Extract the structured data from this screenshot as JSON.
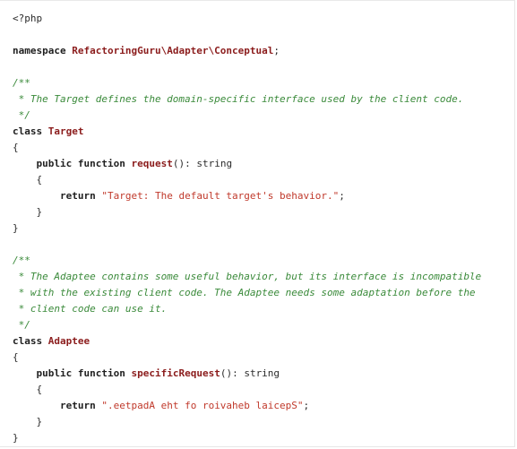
{
  "colors": {
    "background": "#ffffff",
    "text": "#2b2b2b",
    "keyword": "#1f1f1f",
    "class_name": "#8b1c1c",
    "function_name": "#8b1c1c",
    "string": "#c0392b",
    "comment": "#3a8a3a"
  },
  "lines": [
    [
      {
        "t": "<?php",
        "k": "plain"
      }
    ],
    [],
    [
      {
        "t": "namespace",
        "k": "keyword"
      },
      {
        "t": " ",
        "k": "plain"
      },
      {
        "t": "RefactoringGuru\\Adapter\\Conceptual",
        "k": "class"
      },
      {
        "t": ";",
        "k": "plain"
      }
    ],
    [],
    [
      {
        "t": "/**",
        "k": "comment"
      }
    ],
    [
      {
        "t": " * The Target defines the domain-specific interface used by the client code.",
        "k": "comment"
      }
    ],
    [
      {
        "t": " */",
        "k": "comment"
      }
    ],
    [
      {
        "t": "class",
        "k": "keyword"
      },
      {
        "t": " ",
        "k": "plain"
      },
      {
        "t": "Target",
        "k": "class"
      }
    ],
    [
      {
        "t": "{",
        "k": "plain"
      }
    ],
    [
      {
        "t": "    ",
        "k": "plain"
      },
      {
        "t": "public",
        "k": "keyword"
      },
      {
        "t": " ",
        "k": "plain"
      },
      {
        "t": "function",
        "k": "keyword"
      },
      {
        "t": " ",
        "k": "plain"
      },
      {
        "t": "request",
        "k": "func"
      },
      {
        "t": "(): string",
        "k": "plain"
      }
    ],
    [
      {
        "t": "    {",
        "k": "plain"
      }
    ],
    [
      {
        "t": "        ",
        "k": "plain"
      },
      {
        "t": "return",
        "k": "keyword"
      },
      {
        "t": " ",
        "k": "plain"
      },
      {
        "t": "\"Target: The default target's behavior.\"",
        "k": "string"
      },
      {
        "t": ";",
        "k": "plain"
      }
    ],
    [
      {
        "t": "    }",
        "k": "plain"
      }
    ],
    [
      {
        "t": "}",
        "k": "plain"
      }
    ],
    [],
    [
      {
        "t": "/**",
        "k": "comment"
      }
    ],
    [
      {
        "t": " * The Adaptee contains some useful behavior, but its interface is incompatible",
        "k": "comment"
      }
    ],
    [
      {
        "t": " * with the existing client code. The Adaptee needs some adaptation before the",
        "k": "comment"
      }
    ],
    [
      {
        "t": " * client code can use it.",
        "k": "comment"
      }
    ],
    [
      {
        "t": " */",
        "k": "comment"
      }
    ],
    [
      {
        "t": "class",
        "k": "keyword"
      },
      {
        "t": " ",
        "k": "plain"
      },
      {
        "t": "Adaptee",
        "k": "class"
      }
    ],
    [
      {
        "t": "{",
        "k": "plain"
      }
    ],
    [
      {
        "t": "    ",
        "k": "plain"
      },
      {
        "t": "public",
        "k": "keyword"
      },
      {
        "t": " ",
        "k": "plain"
      },
      {
        "t": "function",
        "k": "keyword"
      },
      {
        "t": " ",
        "k": "plain"
      },
      {
        "t": "specificRequest",
        "k": "func"
      },
      {
        "t": "(): string",
        "k": "plain"
      }
    ],
    [
      {
        "t": "    {",
        "k": "plain"
      }
    ],
    [
      {
        "t": "        ",
        "k": "plain"
      },
      {
        "t": "return",
        "k": "keyword"
      },
      {
        "t": " ",
        "k": "plain"
      },
      {
        "t": "\".eetpadA eht fo roivaheb laicepS\"",
        "k": "string"
      },
      {
        "t": ";",
        "k": "plain"
      }
    ],
    [
      {
        "t": "    }",
        "k": "plain"
      }
    ],
    [
      {
        "t": "}",
        "k": "plain"
      }
    ]
  ]
}
